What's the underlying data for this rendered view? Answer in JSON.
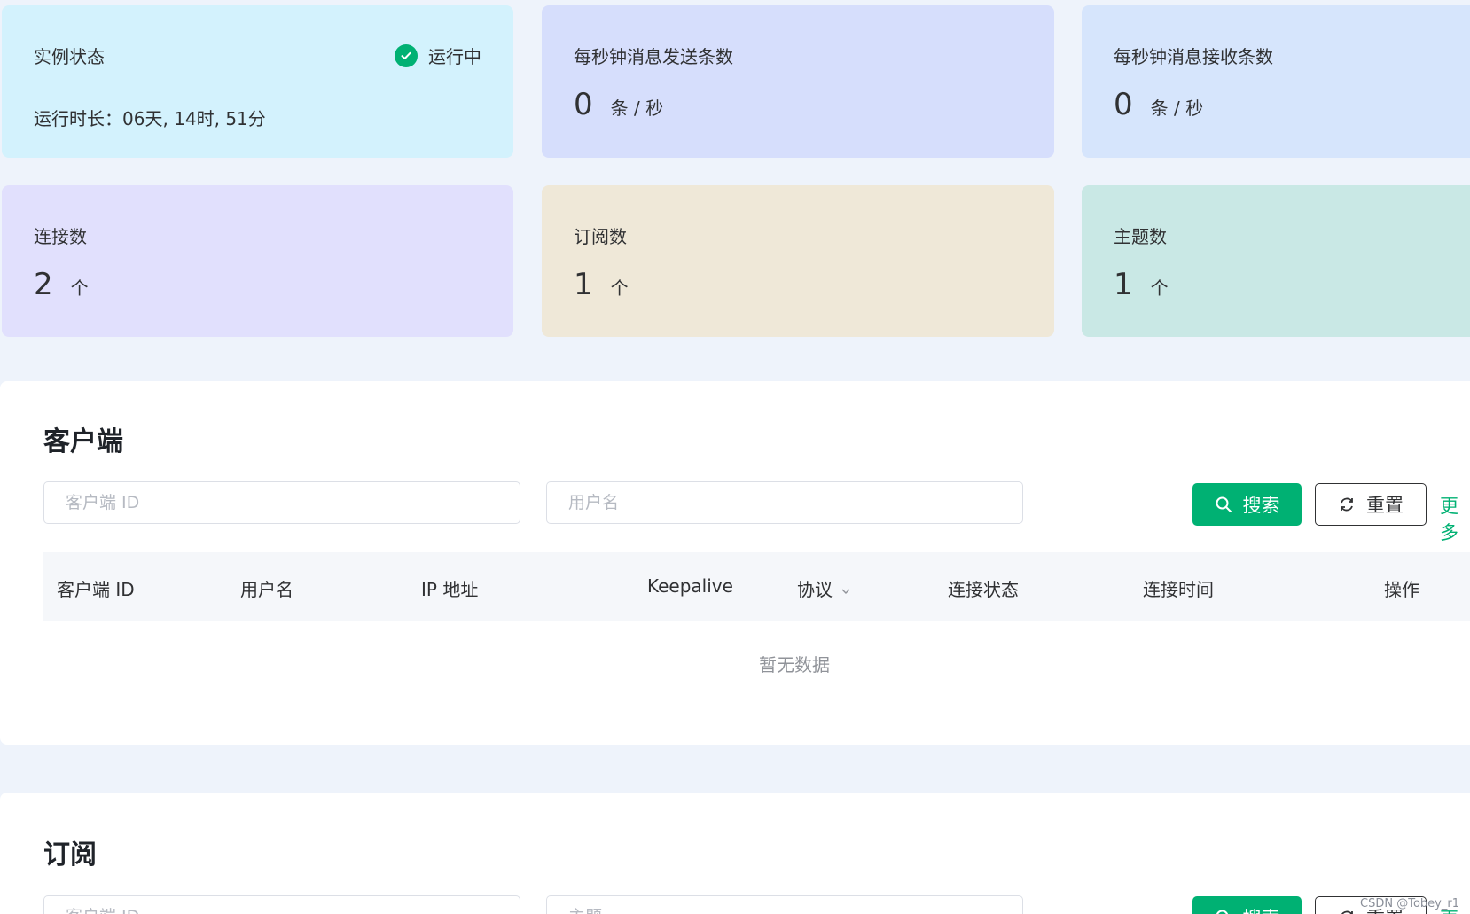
{
  "colors": {
    "accent": "#00b173",
    "page_bg": "#eef3fb",
    "card_status": "#d3f2fd",
    "card_send": "#d6defc",
    "card_recv": "#d6e5fc",
    "card_conn": "#e1e0fd",
    "card_sub": "#efe8d8",
    "card_topic": "#c9e8e5"
  },
  "stats": {
    "status": {
      "label": "实例状态",
      "state": "运行中",
      "uptime": "运行时长：06天, 14时, 51分",
      "icon": "check-circle-icon"
    },
    "send": {
      "label": "每秒钟消息发送条数",
      "value": "0",
      "unit": "条 / 秒"
    },
    "recv": {
      "label": "每秒钟消息接收条数",
      "value": "0",
      "unit": "条 / 秒"
    },
    "connections": {
      "label": "连接数",
      "value": "2",
      "unit": "个"
    },
    "subscriptions": {
      "label": "订阅数",
      "value": "1",
      "unit": "个"
    },
    "topics": {
      "label": "主题数",
      "value": "1",
      "unit": "个"
    }
  },
  "clients": {
    "title": "客户端",
    "client_id_placeholder": "客户端 ID",
    "username_placeholder": "用户名",
    "search_label": "搜索",
    "reset_label": "重置",
    "more_label": "更多",
    "columns": [
      "客户端 ID",
      "用户名",
      "IP 地址",
      "Keepalive",
      "协议",
      "连接状态",
      "连接时间",
      "操作"
    ],
    "empty_text": "暂无数据"
  },
  "subscriptions": {
    "title": "订阅",
    "client_id_placeholder": "客户端 ID",
    "topic_placeholder": "主题",
    "search_label": "搜索",
    "reset_label": "重置",
    "more_label": "更多"
  },
  "watermark": "CSDN @Tobey_r1"
}
